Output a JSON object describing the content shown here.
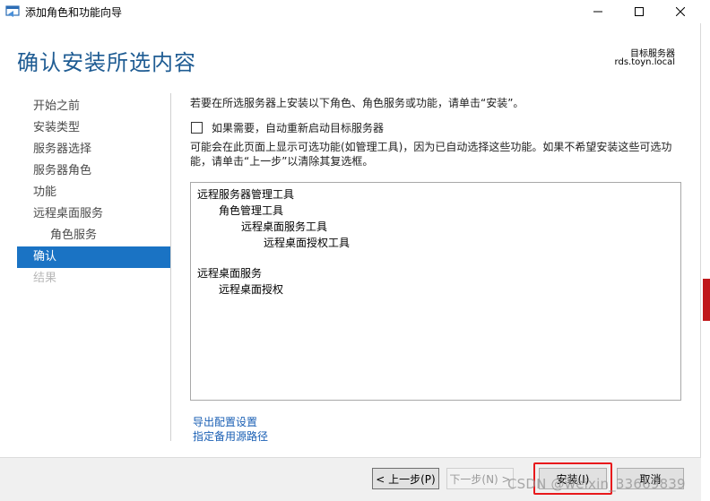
{
  "window": {
    "title": "添加角色和功能向导"
  },
  "header": {
    "page_title": "确认安装所选内容",
    "destination_label": "目标服务器",
    "destination_value": "rds.toyn.local"
  },
  "nav": {
    "items": [
      {
        "label": "开始之前",
        "state": "normal"
      },
      {
        "label": "安装类型",
        "state": "normal"
      },
      {
        "label": "服务器选择",
        "state": "normal"
      },
      {
        "label": "服务器角色",
        "state": "normal"
      },
      {
        "label": "功能",
        "state": "normal"
      },
      {
        "label": "远程桌面服务",
        "state": "normal"
      },
      {
        "label": "角色服务",
        "state": "sub"
      },
      {
        "label": "确认",
        "state": "active"
      },
      {
        "label": "结果",
        "state": "disabled"
      }
    ]
  },
  "content": {
    "intro": "若要在所选服务器上安装以下角色、角色服务或功能，请单击“安装”。",
    "restart_checkbox_label": "如果需要，自动重新启动目标服务器",
    "restart_checked": false,
    "note": "可能会在此页面上显示可选功能(如管理工具)，因为已自动选择这些功能。如果不希望安装这些可选功能，请单击“上一步”以清除其复选框。",
    "tree": [
      {
        "label": "远程服务器管理工具",
        "level": 0
      },
      {
        "label": "角色管理工具",
        "level": 1
      },
      {
        "label": "远程桌面服务工具",
        "level": 2
      },
      {
        "label": "远程桌面授权工具",
        "level": 3
      },
      {
        "label": "远程桌面服务",
        "level": 0
      },
      {
        "label": "远程桌面授权",
        "level": 1
      }
    ],
    "export_link": "导出配置设置",
    "alt_source_link": "指定备用源路径"
  },
  "footer": {
    "prev_label": "< 上一步(P)",
    "next_label": "下一步(N) >",
    "install_label": "安装(I)",
    "cancel_label": "取消"
  },
  "watermark": "CSDN @weixin_33669839",
  "colors": {
    "title_blue": "#1f5c93",
    "nav_active": "#1a73c4",
    "link": "#1a5fb4",
    "highlight_red": "#e8191c"
  }
}
